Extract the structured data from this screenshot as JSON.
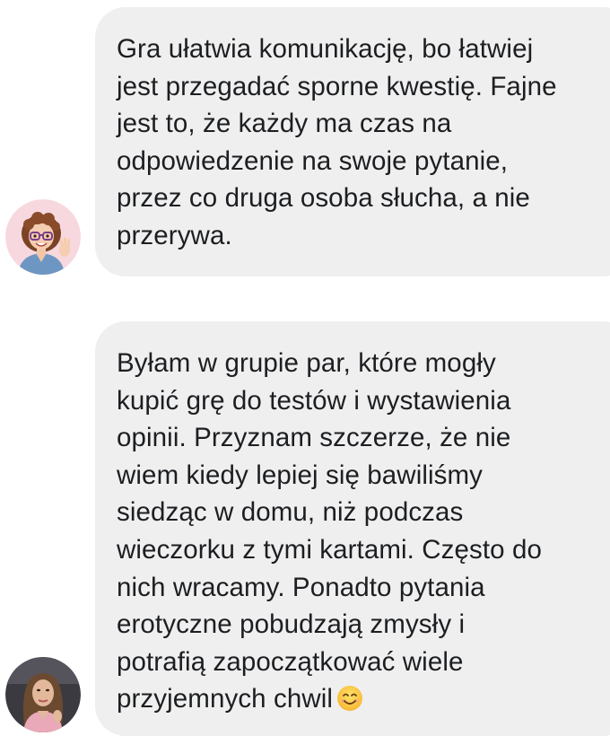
{
  "conversation": {
    "messages": [
      {
        "avatar_icon": "cartoon-woman-avatar-icon",
        "text": "Gra ułatwia komunikację, bo łatwiej\njest przegadać sporne kwestię. Fajne\njest to, że każdy ma czas na\nodpowiedzenie na swoje pytanie,\nprzez co druga osoba słucha, a nie\nprzerywa."
      },
      {
        "avatar_icon": "woman-photo-avatar-icon",
        "text": "Byłam w grupie par, które mogły\nkupić grę do testów i wystawienia\nopinii. Przyznam szczerze, że nie\nwiem kiedy lepiej się bawiliśmy\nsiedząc w domu, niż podczas\nwieczorku z tymi kartami. Często do\nnich wracamy. Ponadto pytania\nerotyczne pobudzają zmysły i\npotrafią zapoczątkować wiele\nprzyjemnych chwil",
        "trailing_emoji": "smiling-face-emoji-icon"
      }
    ]
  },
  "colors": {
    "bubble_background": "#efefef",
    "text": "#1c1e21",
    "page_background": "#ffffff"
  }
}
